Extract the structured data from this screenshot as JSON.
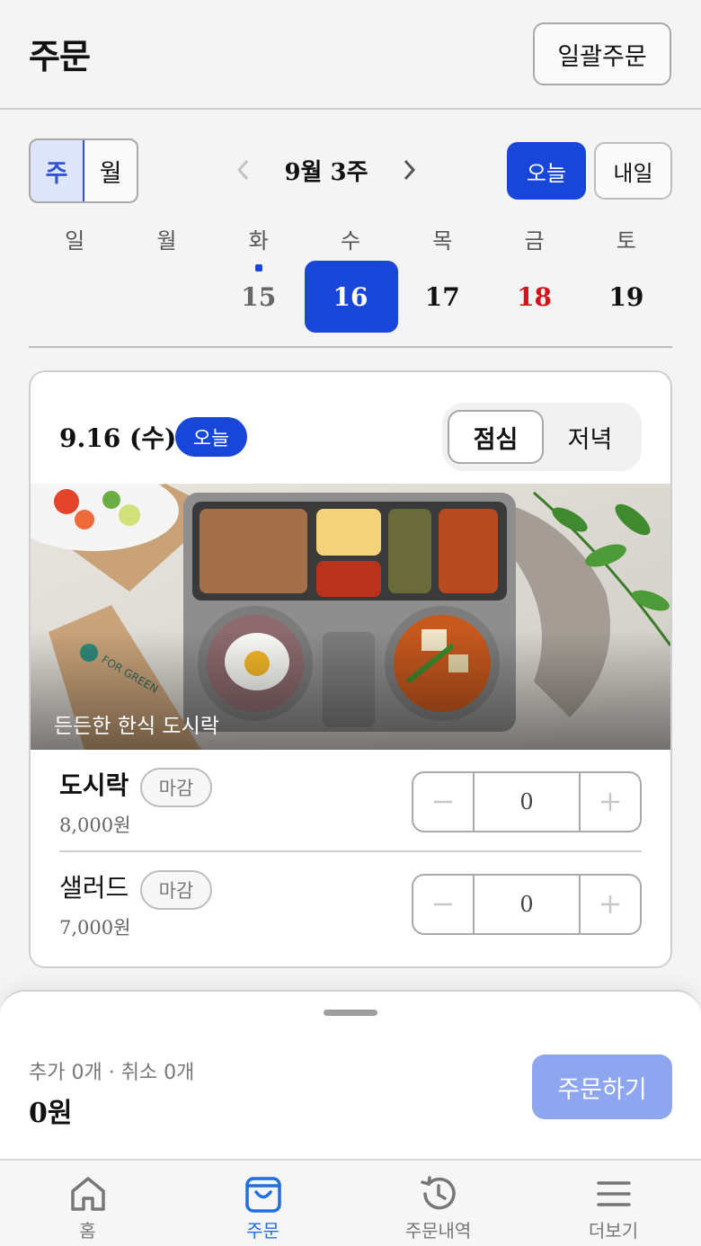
{
  "header": {
    "title": "주문",
    "bulk_order_label": "일괄주문"
  },
  "view_toggle": {
    "week": "주",
    "month": "월",
    "selected": "주"
  },
  "week_nav": {
    "label": "9월 3주"
  },
  "quick_dates": {
    "today": "오늘",
    "tomorrow": "내일"
  },
  "calendar": {
    "weekdays": [
      "일",
      "월",
      "화",
      "수",
      "목",
      "금",
      "토"
    ],
    "dates": [
      "",
      "",
      "15",
      "16",
      "17",
      "18",
      "19"
    ],
    "selected_date": "16",
    "holiday_date": "18",
    "dotted_date": "15"
  },
  "card": {
    "date": "9.16 (수)",
    "today_badge": "오늘",
    "meal_tabs": [
      "점심",
      "저녁"
    ],
    "selected_meal": "점심",
    "image_caption": "든든한 한식 도시락",
    "items": [
      {
        "name": "도시락",
        "status": "마감",
        "price": "8,000원",
        "quantity": "0"
      },
      {
        "name": "샐러드",
        "status": "마감",
        "price": "7,000원",
        "quantity": "0"
      }
    ],
    "minus_icon": "minus-icon",
    "plus_icon": "plus-icon"
  },
  "order_sheet": {
    "summary": "추가 0개 · 취소 0개",
    "total": "0원",
    "order_button": "주문하기"
  },
  "tabbar": {
    "tabs": [
      {
        "label": "홈",
        "icon": "home-icon"
      },
      {
        "label": "주문",
        "icon": "shopping-bag-icon"
      },
      {
        "label": "주문내역",
        "icon": "history-icon"
      },
      {
        "label": "더보기",
        "icon": "menu-icon"
      }
    ],
    "active": "주문"
  },
  "colors": {
    "primary": "#1746d8",
    "holiday": "#d8101b",
    "disabled_primary": "#8ea6f0",
    "active_tab": "#1f6fe0"
  }
}
